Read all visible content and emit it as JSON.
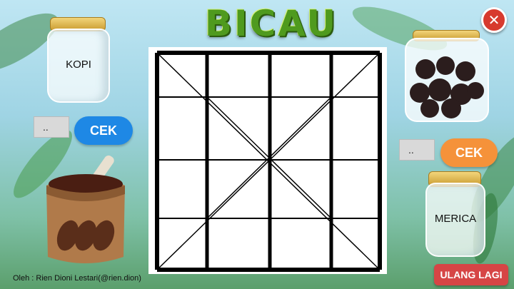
{
  "header": {
    "title": "BICAU",
    "close_icon": "close-x-icon"
  },
  "left_panel": {
    "jar_label": "KOPI",
    "answer_value": "..",
    "check_label": "CEK",
    "check_color": "#1e88e5"
  },
  "right_panel": {
    "jar_label": "MERICA",
    "answer_value": "..",
    "check_label": "CEK",
    "check_color": "#f5923a"
  },
  "board": {
    "rows": 4,
    "cols": 4,
    "line_color": "#000000"
  },
  "footer": {
    "credit": "Oleh : Rien Dioni Lestari(@rien.dion)",
    "reset_label": "ULANG LAGI"
  },
  "colors": {
    "accent_green": "#4f9a1e",
    "close_red": "#d73a2e",
    "reset_red": "#d64545"
  }
}
